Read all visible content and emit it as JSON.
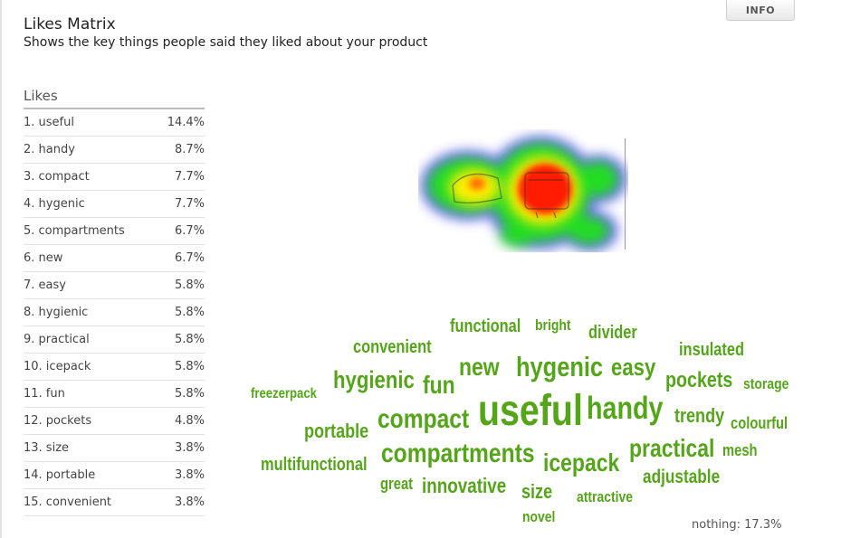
{
  "header": {
    "title": "Likes Matrix",
    "subtitle": "Shows the key things people said they liked about your product",
    "info_label": "INFO"
  },
  "likes": {
    "heading": "Likes",
    "items": [
      {
        "label": "1. useful",
        "value": "14.4%"
      },
      {
        "label": "2. handy",
        "value": "8.7%"
      },
      {
        "label": "3. compact",
        "value": "7.7%"
      },
      {
        "label": "4. hygenic",
        "value": "7.7%"
      },
      {
        "label": "5. compartments",
        "value": "6.7%"
      },
      {
        "label": "6. new",
        "value": "6.7%"
      },
      {
        "label": "7. easy",
        "value": "5.8%"
      },
      {
        "label": "8. hygienic",
        "value": "5.8%"
      },
      {
        "label": "9. practical",
        "value": "5.8%"
      },
      {
        "label": "10. icepack",
        "value": "5.8%"
      },
      {
        "label": "11. fun",
        "value": "5.8%"
      },
      {
        "label": "12. pockets",
        "value": "4.8%"
      },
      {
        "label": "13. size",
        "value": "3.8%"
      },
      {
        "label": "14. portable",
        "value": "3.8%"
      },
      {
        "label": "15. convenient",
        "value": "3.8%"
      }
    ]
  },
  "word_cloud": {
    "color": "#55a51a",
    "words": [
      "functional",
      "bright",
      "divider",
      "convenient",
      "insulated",
      "new",
      "hygenic",
      "easy",
      "hygienic",
      "fun",
      "pockets",
      "storage",
      "freezerpack",
      "useful",
      "handy",
      "compact",
      "trendy",
      "portable",
      "colourful",
      "compartments",
      "practical",
      "mesh",
      "multifunctional",
      "icepack",
      "adjustable",
      "great",
      "innovative",
      "size",
      "attractive",
      "novel"
    ]
  },
  "footer": {
    "nothing_note": "nothing: 17.3%"
  },
  "colors": {
    "heat_high": "#ff0000",
    "heat_mid": "#ffff00",
    "heat_low": "#22dd22",
    "heat_edge": "#4444ff"
  }
}
